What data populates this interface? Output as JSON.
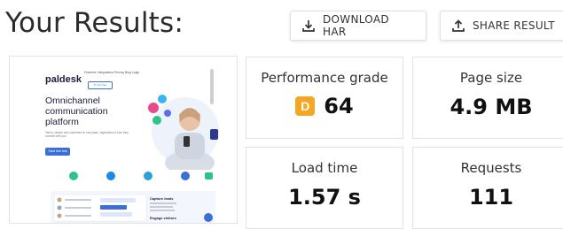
{
  "page": {
    "title": "Your Results:"
  },
  "toolbar": {
    "download_label": "DOWNLOAD HAR",
    "share_label": "SHARE RESULT"
  },
  "thumbnail": {
    "logo": "paldesk",
    "nav": "Features   Integrations   Pricing   Blog   Login",
    "nav_button": "Try for free",
    "headline": "Omnichannel communication platform",
    "subtext": "Talk to visitors and customers in one place, regardless of how they connect with you",
    "cta": "Start free trial",
    "side_heading": "Capture leads",
    "side_heading2": "Engage visitors"
  },
  "metrics": {
    "grade_label": "Performance grade",
    "grade_letter": "D",
    "grade_value": "64",
    "size_label": "Page size",
    "size_value": "4.9 MB",
    "load_label": "Load time",
    "load_value": "1.57 s",
    "requests_label": "Requests",
    "requests_value": "111"
  },
  "colors": {
    "grade_badge": "#f5a623",
    "accent": "#3b6fd8"
  },
  "icons": {
    "download": "download-icon",
    "share": "share-icon"
  }
}
